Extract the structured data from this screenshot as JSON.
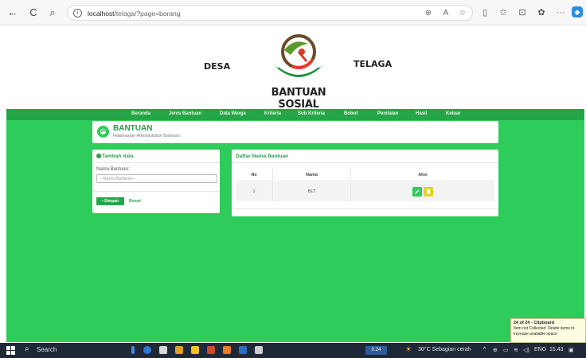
{
  "browser": {
    "url_host": "localhost",
    "url_path": "/telaga/?page=barang",
    "back_icon": "←",
    "refresh_icon": "C",
    "search_icon": "⌕"
  },
  "header": {
    "left_word": "DESA",
    "right_word": "TELAGA",
    "brand": "BANTUAN SOSIAL"
  },
  "nav": {
    "items": [
      "Beranda",
      "Jenis Bantuan",
      "Data Warga",
      "Kriteria",
      "Sub Kriteria",
      "Bobot",
      "Penilaian",
      "Hasil",
      "Keluar"
    ]
  },
  "page_title": {
    "title": "BANTUAN",
    "subtitle": "Halamanan Administrator Bantuan"
  },
  "form": {
    "heading": "Tambah data",
    "label": "Nama Bantuan:",
    "placeholder": "--Nama Bantuan--",
    "save_label": "Simpan",
    "reset_label": "Reset"
  },
  "table": {
    "heading": "Daftar Nama Bantuan",
    "columns": [
      "No",
      "Nama",
      "Aksi"
    ],
    "rows": [
      {
        "no": "1",
        "nama": "BLT"
      }
    ]
  },
  "notification": {
    "title": "24 of 24 - Clipboard",
    "body": "Item not Collected: Delete items to increase available space"
  },
  "taskbar": {
    "search_label": "Search",
    "badge": "0.24",
    "weather": "30°C  Sebagian cerah",
    "lang": "ENG",
    "time": "15.43"
  },
  "colors": {
    "green_bg": "#2ecc5a",
    "green_dark": "#26a548",
    "title_green": "#2a9d49",
    "delete_yellow": "#e4d030"
  }
}
